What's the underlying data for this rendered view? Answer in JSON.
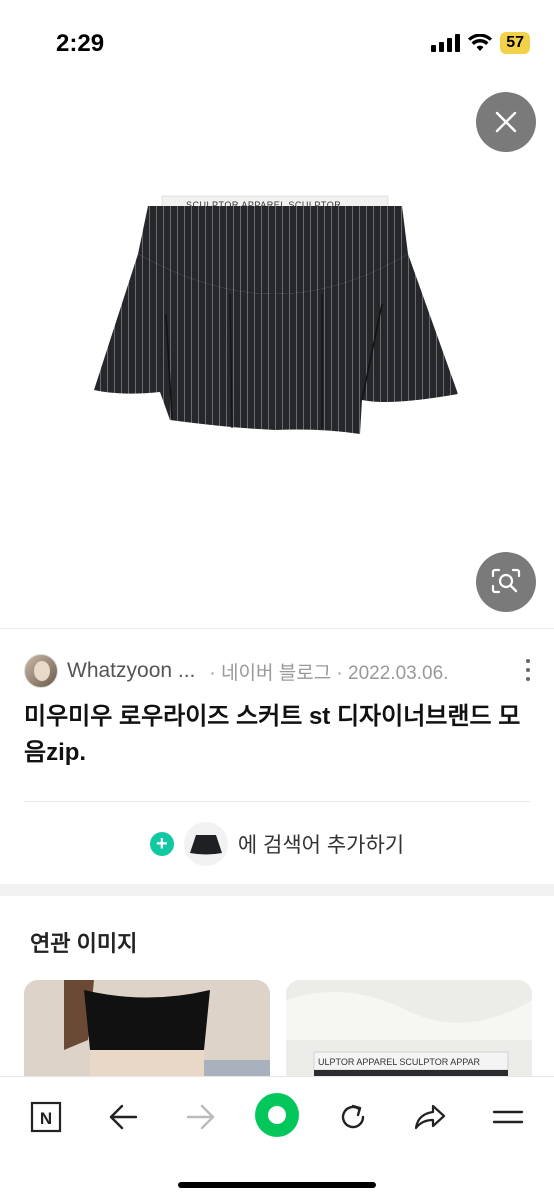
{
  "status_bar": {
    "time": "2:29",
    "battery": "57",
    "battery_color": "#f3d24a"
  },
  "viewer": {
    "close_icon": "close-icon",
    "lens_icon": "image-search-icon",
    "product_image": "pinstripe-pleated-mini-skirt",
    "waistband_text": "SCULPTOR APPAREL SCULPTOR"
  },
  "source": {
    "name": "Whatzyoon ...",
    "meta": "· 네이버 블로그 · 2022.03.06.",
    "more_icon": "more-vertical-icon"
  },
  "title": "미우미우 로우라이즈 스커트 st 디자이너브랜드 모음zip.",
  "add_keyword": {
    "icon": "plus-circle-icon",
    "text": "에 검색어 추가하기",
    "accent": "#10c9a2"
  },
  "related": {
    "title": "연관 이미지",
    "card2_text": "ULPTOR APPAREL SCULPTOR APPAR"
  },
  "toolbar": {
    "items": [
      "naver-home-icon",
      "back-arrow-icon",
      "forward-arrow-icon",
      "green-dot-button",
      "refresh-icon",
      "share-icon",
      "menu-icon"
    ],
    "n_label": "N",
    "accent": "#03c75a"
  }
}
